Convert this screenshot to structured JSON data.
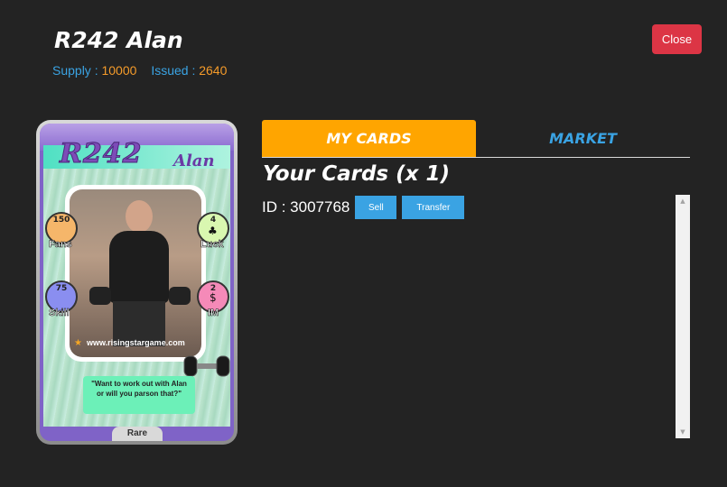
{
  "header": {
    "title": "R242 Alan",
    "supply_label": "Supply :",
    "supply_value": "10000",
    "issued_label": "Issued :",
    "issued_value": "2640",
    "close_label": "Close"
  },
  "card": {
    "code": "R242",
    "name": "Alan",
    "stats": {
      "fans": {
        "value": "150",
        "label": "Fans"
      },
      "luck": {
        "value": "4",
        "label": "Luck"
      },
      "skill": {
        "value": "75",
        "label": "Skill"
      },
      "im": {
        "value": "2",
        "label": "IM"
      }
    },
    "website": "www.risingstargame.com",
    "quote": "\"Want to work out with Alan or will you parson that?\"",
    "rarity": "Rare"
  },
  "tabs": [
    {
      "label": "MY CARDS",
      "active": true
    },
    {
      "label": "MARKET",
      "active": false
    }
  ],
  "my_cards": {
    "heading": "Your Cards (x 1)",
    "items": [
      {
        "id_text": "ID : 3007768",
        "sell_label": "Sell",
        "transfer_label": "Transfer"
      }
    ]
  },
  "colors": {
    "accent_orange": "#ffa500",
    "link_blue": "#3aa3e3",
    "close_red": "#dc3545"
  }
}
